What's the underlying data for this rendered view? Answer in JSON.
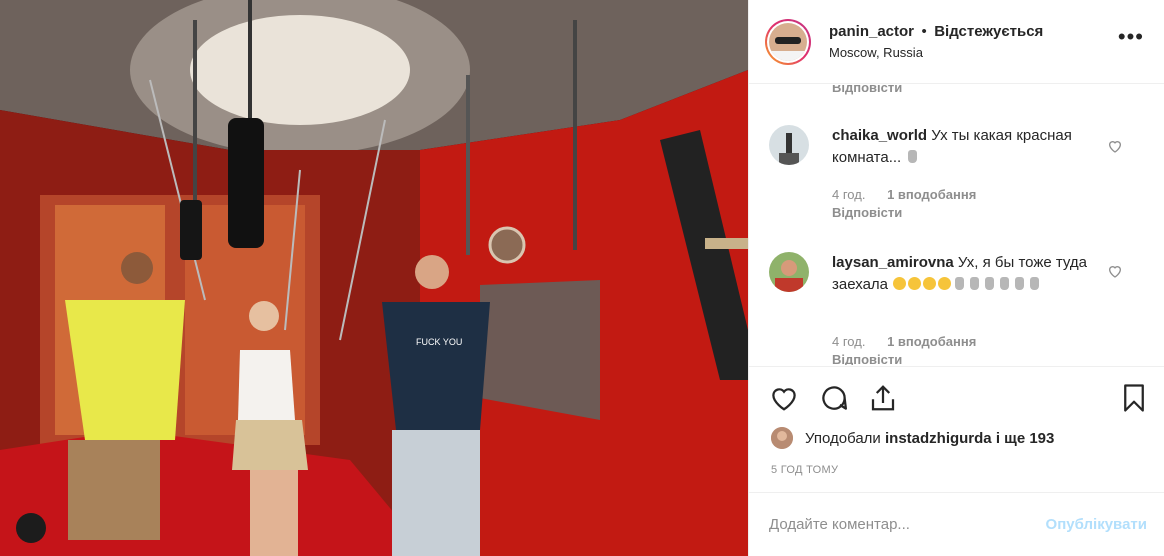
{
  "header": {
    "username": "panin_actor",
    "separator": "•",
    "follow_label": "Відстежується",
    "location": "Moscow, Russia",
    "more_label": "•••"
  },
  "comments": {
    "partial_reply_label": "Відповісти",
    "items": [
      {
        "username": "chaika_world",
        "text": "Ух ты какая красная комната...",
        "time": "4 год.",
        "likes": "1 вподобання",
        "reply_label": "Відповісти"
      },
      {
        "username": "laysan_amirovna",
        "text": "Ух, я бы тоже туда заехала",
        "time": "4 год.",
        "likes": "1 вподобання",
        "reply_label": "Відповісти"
      }
    ]
  },
  "actions": {
    "liked_by_prefix": "Уподобали",
    "liked_by_user": "instadzhigurda",
    "liked_by_suffix": "і ще 193",
    "time_ago": "5 ГОД ТОМУ"
  },
  "add_comment": {
    "placeholder": "Додайте коментар...",
    "publish_label": "Опублікувати"
  },
  "colors": {
    "wall_red": "#c21a12",
    "link_blue": "#b2dffc",
    "muted": "#8e8e8e"
  }
}
